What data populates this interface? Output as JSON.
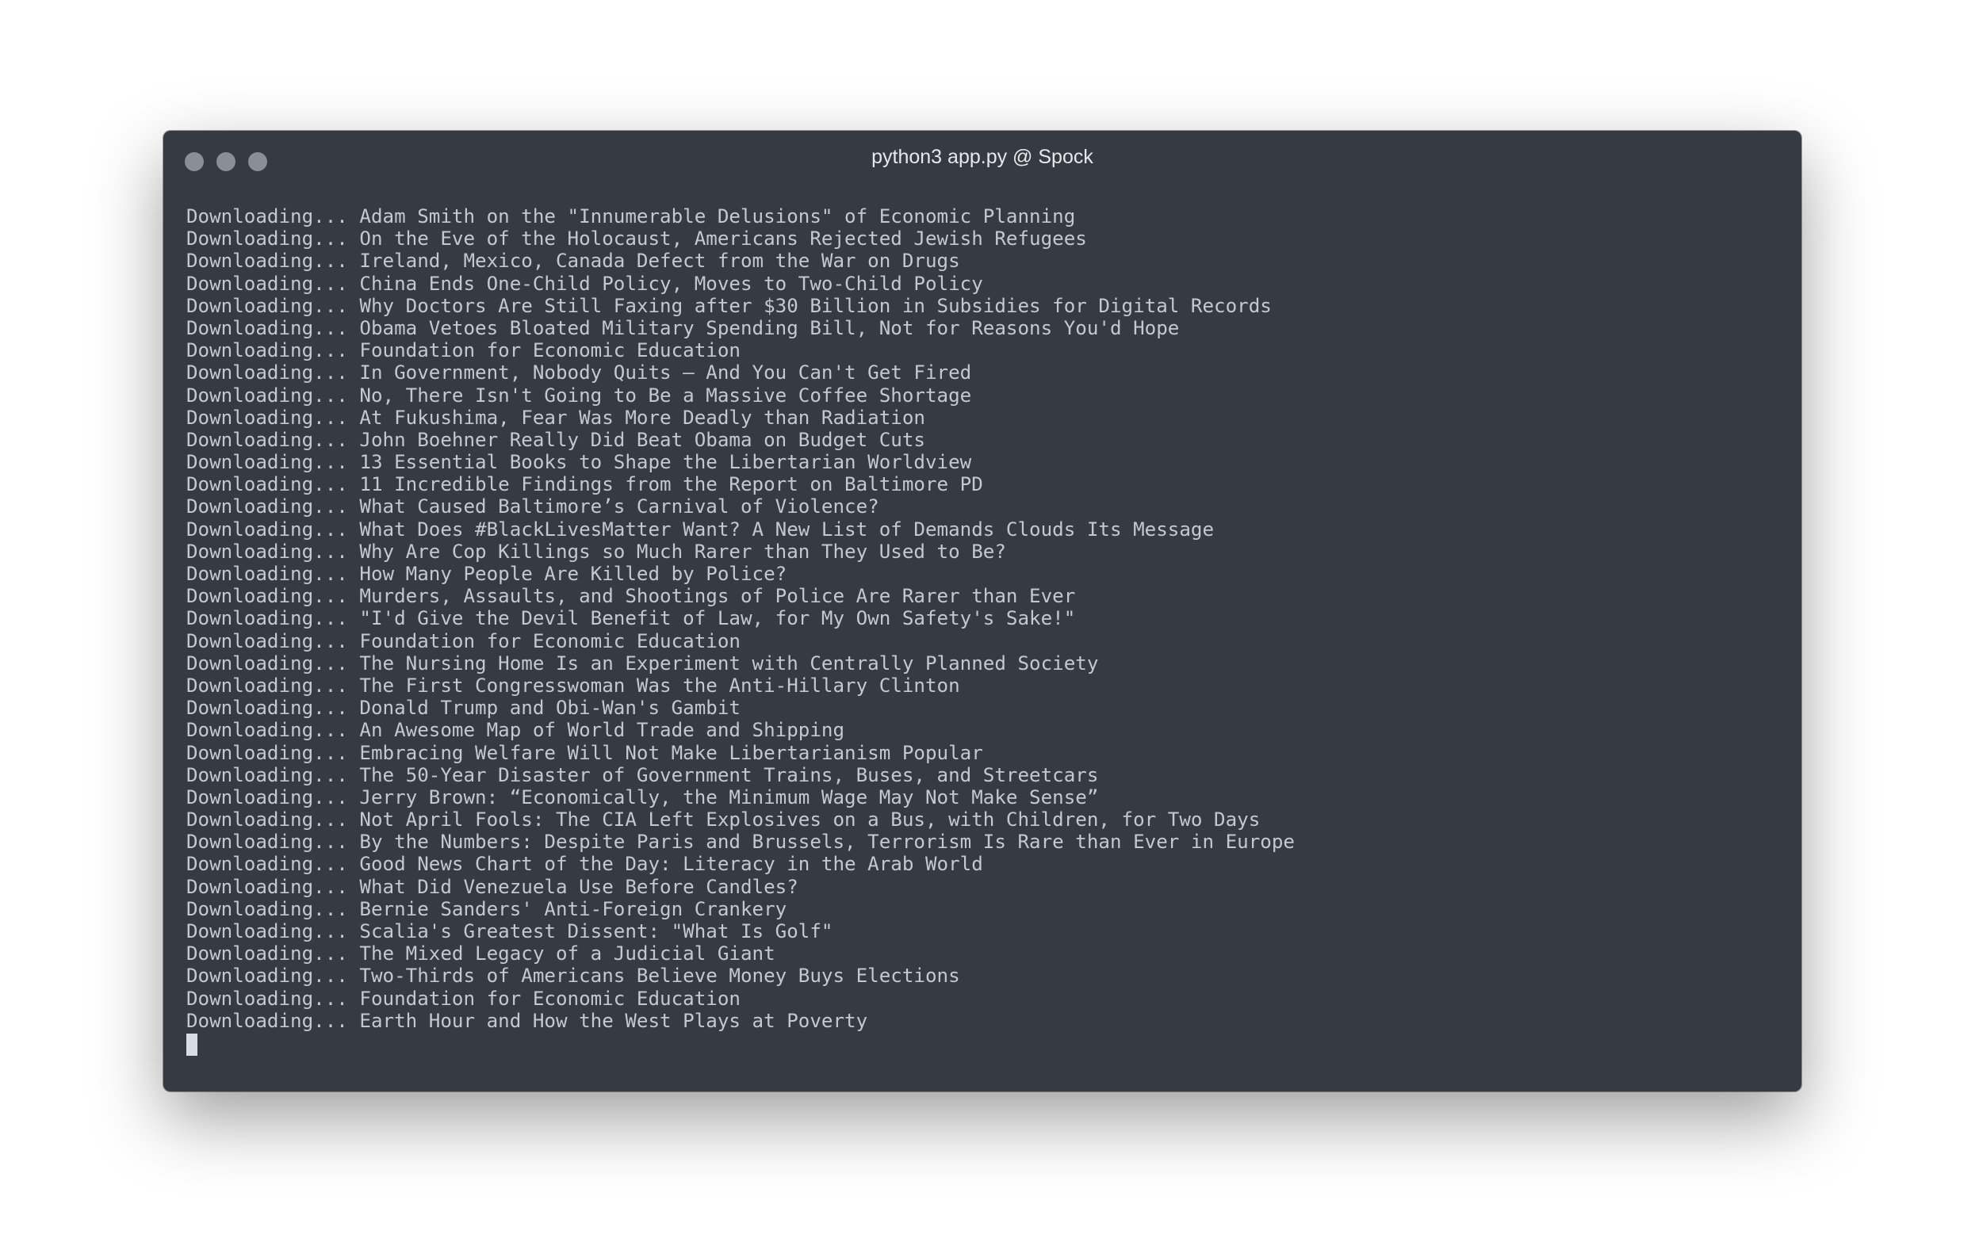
{
  "window": {
    "title": "python3 app.py @ Spock"
  },
  "terminal": {
    "lines": [
      "Downloading... Adam Smith on the \"Innumerable Delusions\" of Economic Planning",
      "Downloading... On the Eve of the Holocaust, Americans Rejected Jewish Refugees",
      "Downloading... Ireland, Mexico, Canada Defect from the War on Drugs",
      "Downloading... China Ends One-Child Policy, Moves to Two-Child Policy",
      "Downloading... Why Doctors Are Still Faxing after $30 Billion in Subsidies for Digital Records",
      "Downloading... Obama Vetoes Bloated Military Spending Bill, Not for Reasons You'd Hope",
      "Downloading... Foundation for Economic Education",
      "Downloading... In Government, Nobody Quits – And You Can't Get Fired",
      "Downloading... No, There Isn't Going to Be a Massive Coffee Shortage",
      "Downloading... At Fukushima, Fear Was More Deadly than Radiation",
      "Downloading... John Boehner Really Did Beat Obama on Budget Cuts",
      "Downloading... 13 Essential Books to Shape the Libertarian Worldview",
      "Downloading... 11 Incredible Findings from the Report on Baltimore PD",
      "Downloading... What Caused Baltimore’s Carnival of Violence?",
      "Downloading... What Does #BlackLivesMatter Want? A New List of Demands Clouds Its Message",
      "Downloading... Why Are Cop Killings so Much Rarer than They Used to Be?",
      "Downloading... How Many People Are Killed by Police?",
      "Downloading... Murders, Assaults, and Shootings of Police Are Rarer than Ever",
      "Downloading... \"I'd Give the Devil Benefit of Law, for My Own Safety's Sake!\"",
      "Downloading... Foundation for Economic Education",
      "Downloading... The Nursing Home Is an Experiment with Centrally Planned Society",
      "Downloading... The First Congresswoman Was the Anti-Hillary Clinton",
      "Downloading... Donald Trump and Obi-Wan's Gambit",
      "Downloading... An Awesome Map of World Trade and Shipping",
      "Downloading... Embracing Welfare Will Not Make Libertarianism Popular",
      "Downloading... The 50-Year Disaster of Government Trains, Buses, and Streetcars",
      "Downloading... Jerry Brown: “Economically, the Minimum Wage May Not Make Sense”",
      "Downloading... Not April Fools: The CIA Left Explosives on a Bus, with Children, for Two Days",
      "Downloading... By the Numbers: Despite Paris and Brussels, Terrorism Is Rare than Ever in Europe",
      "Downloading... Good News Chart of the Day: Literacy in the Arab World",
      "Downloading... What Did Venezuela Use Before Candles?",
      "Downloading... Bernie Sanders' Anti-Foreign Crankery",
      "Downloading... Scalia's Greatest Dissent: \"What Is Golf\"",
      "Downloading... The Mixed Legacy of a Judicial Giant",
      "Downloading... Two-Thirds of Americans Believe Money Buys Elections",
      "Downloading... Foundation for Economic Education",
      "Downloading... Earth Hour and How the West Plays at Poverty"
    ]
  }
}
